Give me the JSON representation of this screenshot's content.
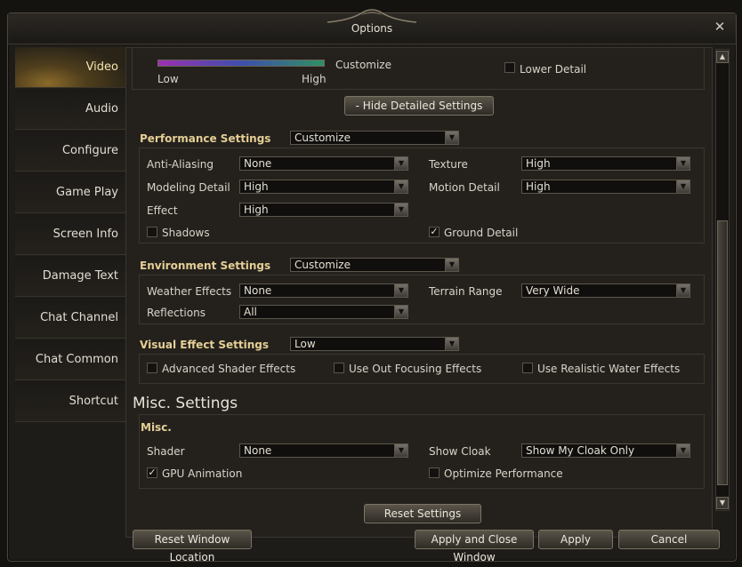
{
  "window": {
    "title": "Options",
    "close": "✕"
  },
  "sidebar": {
    "items": [
      {
        "label": "Video",
        "active": true
      },
      {
        "label": "Audio"
      },
      {
        "label": "Configure"
      },
      {
        "label": "Game Play"
      },
      {
        "label": "Screen Info"
      },
      {
        "label": "Damage Text"
      },
      {
        "label": "Chat Channel"
      },
      {
        "label": "Chat Common"
      },
      {
        "label": "Shortcut"
      }
    ]
  },
  "quality": {
    "low": "Low",
    "high": "High",
    "mode": "Customize",
    "lower_detail": "Lower Detail"
  },
  "hide_detailed_button": "-   Hide Detailed Settings",
  "performance": {
    "title": "Performance Settings",
    "preset": "Customize",
    "anti_aliasing": {
      "label": "Anti-Aliasing",
      "value": "None"
    },
    "texture": {
      "label": "Texture",
      "value": "High"
    },
    "modeling_detail": {
      "label": "Modeling Detail",
      "value": "High"
    },
    "motion_detail": {
      "label": "Motion Detail",
      "value": "High"
    },
    "effect": {
      "label": "Effect",
      "value": "High"
    },
    "shadows": {
      "label": "Shadows",
      "checked": false
    },
    "ground_detail": {
      "label": "Ground Detail",
      "checked": true
    }
  },
  "environment": {
    "title": "Environment Settings",
    "preset": "Customize",
    "weather_effects": {
      "label": "Weather Effects",
      "value": "None"
    },
    "terrain_range": {
      "label": "Terrain Range",
      "value": "Very Wide"
    },
    "reflections": {
      "label": "Reflections",
      "value": "All"
    }
  },
  "visual_effect": {
    "title": "Visual Effect Settings",
    "preset": "Low",
    "advanced_shader": {
      "label": "Advanced Shader Effects",
      "checked": false
    },
    "out_focusing": {
      "label": "Use Out Focusing Effects",
      "checked": false
    },
    "realistic_water": {
      "label": "Use Realistic Water Effects",
      "checked": false
    }
  },
  "misc": {
    "heading": "Misc. Settings",
    "title": "Misc.",
    "shader": {
      "label": "Shader",
      "value": "None"
    },
    "show_cloak": {
      "label": "Show Cloak",
      "value": "Show My Cloak Only"
    },
    "gpu_animation": {
      "label": "GPU Animation",
      "checked": true
    },
    "optimize_performance": {
      "label": "Optimize Performance",
      "checked": false
    }
  },
  "buttons": {
    "reset_settings": "Reset Settings",
    "reset_window_location": "Reset Window Location",
    "apply_close": "Apply and Close Window",
    "apply": "Apply",
    "cancel": "Cancel"
  },
  "colors": {
    "accent": "#e4cf95",
    "active_tab": "#8a6a2a"
  }
}
